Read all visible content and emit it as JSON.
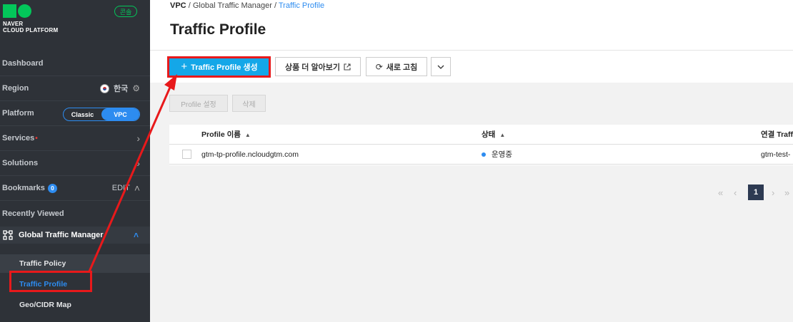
{
  "sidebar": {
    "logo_line1": "NAVER",
    "logo_line2": "CLOUD PLATFORM",
    "console_badge": "콘솔",
    "dashboard": "Dashboard",
    "region_label": "Region",
    "region_value": "한국",
    "platform_label": "Platform",
    "platform_options": [
      "Classic",
      "VPC"
    ],
    "platform_selected": "VPC",
    "services": "Services",
    "solutions": "Solutions",
    "bookmarks": "Bookmarks",
    "bookmarks_count": "0",
    "bookmarks_edit": "EDIT",
    "recently_viewed": "Recently Viewed",
    "group_title": "Global Traffic Manager",
    "sub_items": [
      "Traffic Policy",
      "Traffic Profile",
      "Geo/CIDR Map"
    ]
  },
  "breadcrumb": {
    "root": "VPC",
    "sep": "/",
    "parent": "Global Traffic Manager",
    "current": "Traffic Profile"
  },
  "page_title": "Traffic Profile",
  "toolbar": {
    "create_label": "Traffic Profile 생성",
    "create_icon": "+",
    "learn_label": "상품 더 알아보기",
    "refresh_label": "새로 고침",
    "more_icon": "chevron-down"
  },
  "actions": {
    "profile_settings": "Profile 설정",
    "delete": "삭제"
  },
  "table": {
    "headers": [
      "Profile 이름",
      "상태",
      "연결 Traff"
    ],
    "rows": [
      {
        "name": "gtm-tp-profile.ncloudgtm.com",
        "status": "운영중",
        "linked": "gtm-test-"
      }
    ]
  },
  "pagination": {
    "current_page": "1"
  },
  "colors": {
    "accent": "#14a7e8",
    "annotation": "#e8191b",
    "sidebar_bg": "#2e3238"
  }
}
